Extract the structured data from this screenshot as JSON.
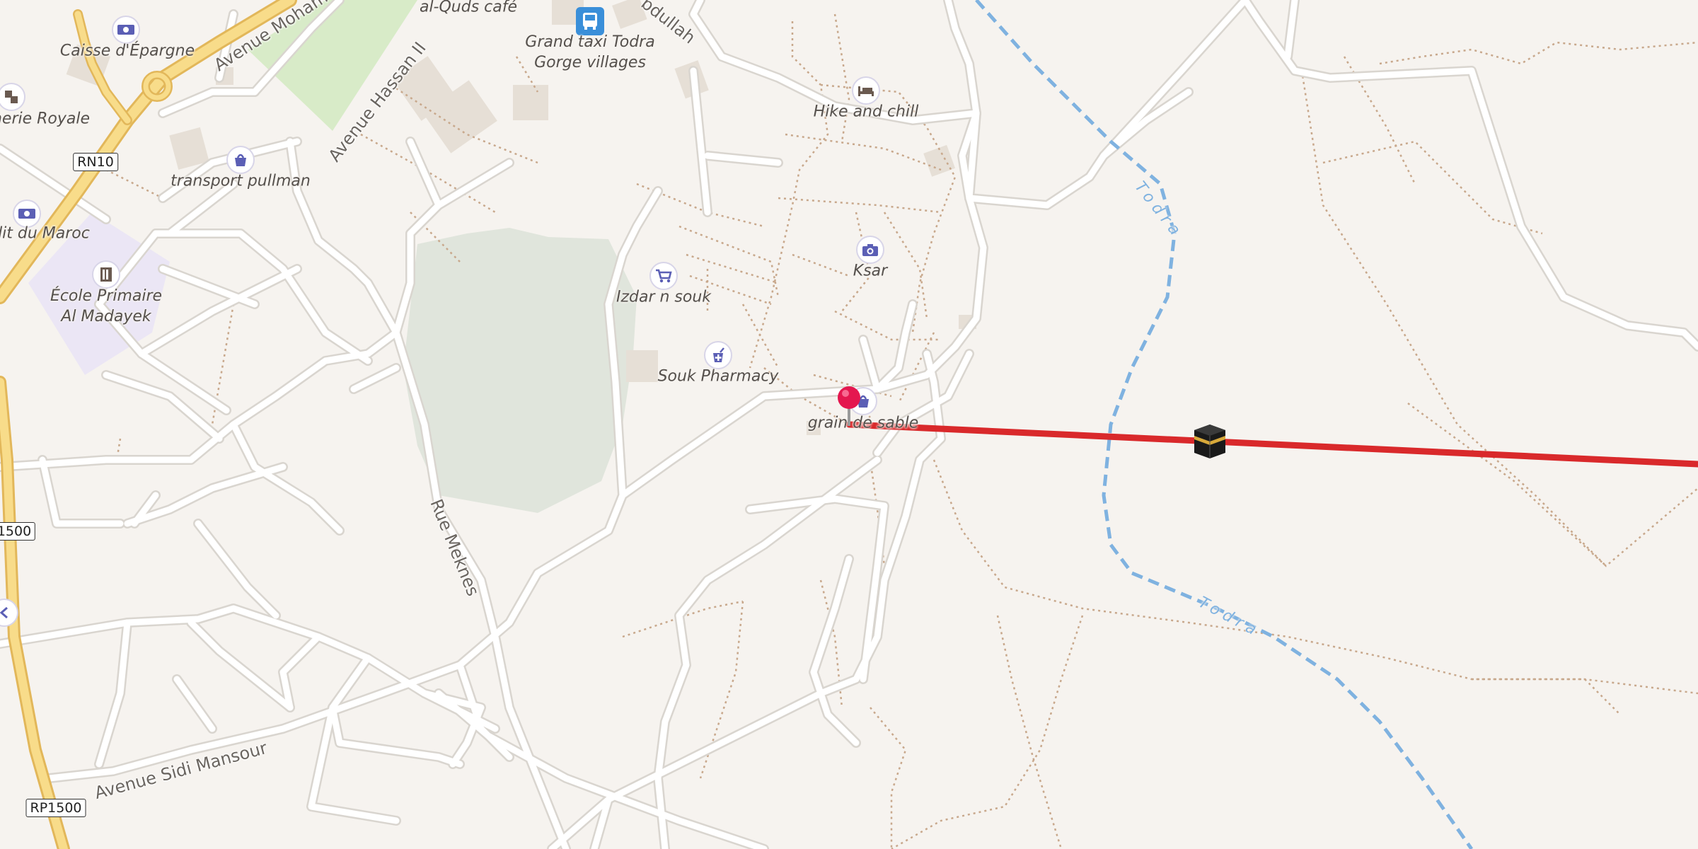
{
  "map": {
    "colors": {
      "background": "#f6f3ef",
      "road_fill": "#ffffff",
      "road_casing": "#d9d5cf",
      "trunk_fill": "#f8dc8a",
      "trunk_casing": "#e2b75a",
      "park": "#d8ebc8",
      "school_area": "#ebe6f5",
      "wood": "#e0e5dc",
      "building": "#e6dfd6",
      "river": "#7fb2e0",
      "route_line": "#d9292b",
      "pin": "#e4174f",
      "poi_icon": "#5b5fb5"
    },
    "roads": {
      "avenue_mohammed": "Avenue Moham",
      "avenue_hassan_ii": "Avenue Hassan II",
      "rue_meknes": "Rue Meknes",
      "avenue_sidi_mansour": "Avenue Sidi Mansour",
      "abdullah": "bdullah"
    },
    "shields": {
      "rn10": "RN10",
      "rp1500_left": "1500",
      "rp1500_bottom": "RP1500"
    },
    "pois": {
      "caisse": "Caisse d'Épargne",
      "royale": "nerie Royale",
      "credit": "dit du Maroc",
      "transport": "transport pullman",
      "ecole": "École Primaire\nAl Madayek",
      "alquds": "al-Quds café",
      "grand_taxi": "Grand taxi Todra\nGorge villages",
      "hike": "Hike and chill",
      "ksar": "Ksar",
      "izdar": "Izdar n souk",
      "souk_pharmacy": "Souk Pharmacy",
      "grain": "grain de sable"
    },
    "river": {
      "name1": "Todra",
      "name2": "Todra"
    }
  }
}
